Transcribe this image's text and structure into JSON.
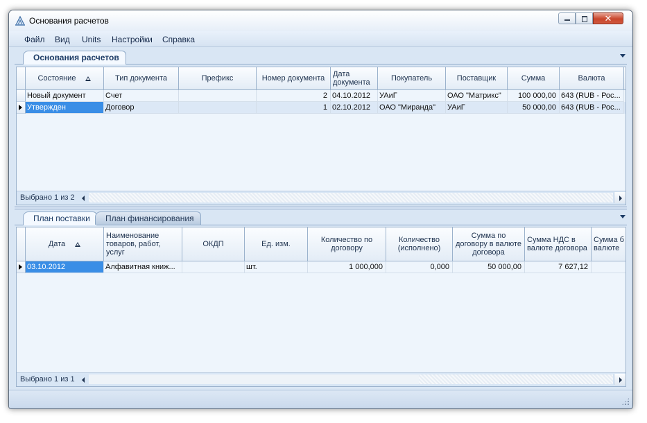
{
  "window": {
    "title": "Основания расчетов"
  },
  "menu": [
    "Файл",
    "Вид",
    "Units",
    "Настройки",
    "Справка"
  ],
  "top_tabs": [
    "Основания расчетов"
  ],
  "top_grid": {
    "columns": [
      "Состояние",
      "Тип документа",
      "Префикс",
      "Номер документа",
      "Дата документа",
      "Покупатель",
      "Поставщик",
      "Сумма",
      "Валюта"
    ],
    "rows": [
      [
        "Новый документ",
        "Счет",
        "",
        "2",
        "04.10.2012",
        "УАиГ",
        "ОАО \"Матрикс\"",
        "100 000,00",
        "643 (RUB - Рос..."
      ],
      [
        "Утвержден",
        "Договор",
        "",
        "1",
        "02.10.2012",
        "ОАО \"Миранда\"",
        "УАиГ",
        "50 000,00",
        "643 (RUB - Рос..."
      ]
    ],
    "selected_row": 1,
    "footer": "Выбрано 1 из 2"
  },
  "bottom_tabs": [
    "План поставки",
    "План финансирования"
  ],
  "bottom_grid": {
    "columns": [
      "Дата",
      "Наименование товаров, работ, услуг",
      "ОКДП",
      "Ед. изм.",
      "Количество по договору",
      "Количество (исполнено)",
      "Сумма по договору в валюте договора",
      "Сумма НДС в валюте договора",
      "Сумма б валюте"
    ],
    "rows": [
      [
        "03.10.2012",
        "Алфавитная книж...",
        "",
        "шт.",
        "1 000,000",
        "0,000",
        "50 000,00",
        "7 627,12",
        ""
      ]
    ],
    "selected_row": 0,
    "footer": "Выбрано 1 из 1"
  },
  "colors": {
    "selection": "#3a8ee6",
    "tab_active_text": "#1d3c66",
    "close_button": "#c9462c"
  }
}
